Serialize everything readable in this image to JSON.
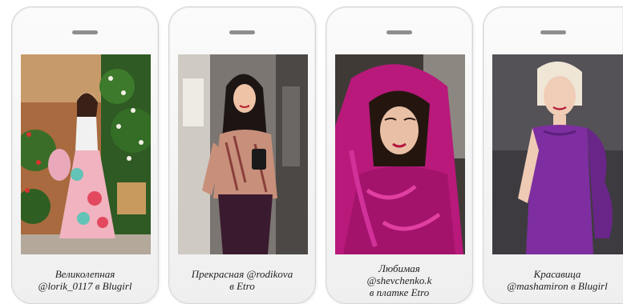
{
  "phones": [
    {
      "caption_lines": [
        "Великолепная",
        "@lorik_0117 в Blugirl"
      ],
      "photo": "woman-in-floral-dress-photo"
    },
    {
      "caption_lines": [
        "Прекрасная @rodikova",
        "в Etro"
      ],
      "photo": "woman-in-printed-blouse-photo"
    },
    {
      "caption_lines": [
        "Любимая",
        "@shevchenko.k",
        "в платке Etro"
      ],
      "photo": "woman-in-pink-scarf-photo"
    },
    {
      "caption_lines": [
        "Красавица",
        "@mashamiron в Blugirl"
      ],
      "photo": "woman-in-purple-dress-photo"
    }
  ]
}
